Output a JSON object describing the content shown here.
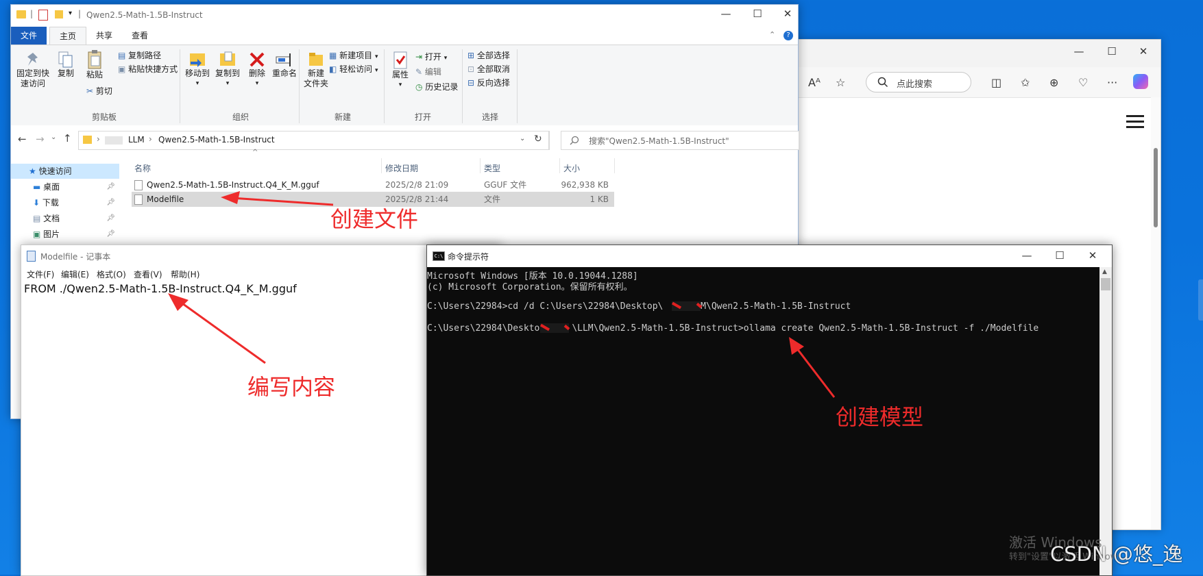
{
  "browser": {
    "search_placeholder": "点此搜索",
    "win_controls": [
      "—",
      "☐",
      "✕"
    ],
    "toolbar_icons": [
      "read-aloud-icon",
      "favorite-star-icon",
      "split-screen-icon",
      "favorites-icon",
      "collections-icon",
      "browser-essentials-icon",
      "more-icon",
      "copilot-icon"
    ]
  },
  "explorer": {
    "title": "Qwen2.5-Math-1.5B-Instruct",
    "tabs": [
      "文件",
      "主页",
      "共享",
      "查看"
    ],
    "ribbon": {
      "clipboard": {
        "pin_quick_access": "固定到快\n速访问",
        "copy": "复制",
        "paste": "粘贴",
        "copy_path": "复制路径",
        "paste_shortcut": "粘贴快捷方式",
        "cut": "剪切",
        "group_label": "剪贴板"
      },
      "organize": {
        "move_to": "移动到",
        "copy_to": "复制到",
        "delete": "删除",
        "rename": "重命名",
        "group_label": "组织"
      },
      "new": {
        "new_folder": "新建\n文件夹",
        "new_item": "新建项目",
        "easy_access": "轻松访问",
        "group_label": "新建"
      },
      "open": {
        "properties": "属性",
        "open": "打开",
        "edit": "编辑",
        "history": "历史记录",
        "group_label": "打开"
      },
      "select": {
        "select_all": "全部选择",
        "select_none": "全部取消",
        "invert": "反向选择",
        "group_label": "选择"
      }
    },
    "address": {
      "seg1": "LLM",
      "seg2": "Qwen2.5-Math-1.5B-Instruct",
      "search_placeholder": "搜索\"Qwen2.5-Math-1.5B-Instruct\""
    },
    "nav": {
      "quick_access": "快速访问",
      "items": [
        "桌面",
        "下载",
        "文档",
        "图片"
      ]
    },
    "columns": {
      "name": "名称",
      "modified": "修改日期",
      "type": "类型",
      "size": "大小"
    },
    "files": [
      {
        "name": "Qwen2.5-Math-1.5B-Instruct.Q4_K_M.gguf",
        "modified": "2025/2/8 21:09",
        "type": "GGUF 文件",
        "size": "962,938 KB"
      },
      {
        "name": "Modelfile",
        "modified": "2025/2/8 21:44",
        "type": "文件",
        "size": "1 KB"
      }
    ]
  },
  "notepad": {
    "title": "Modelfile - 记事本",
    "menu": [
      "文件(F)",
      "编辑(E)",
      "格式(O)",
      "查看(V)",
      "帮助(H)"
    ],
    "content": "FROM ./Qwen2.5-Math-1.5B-Instruct.Q4_K_M.gguf"
  },
  "cmd": {
    "title": "命令提示符",
    "lines": [
      "Microsoft Windows [版本 10.0.19044.1288]",
      "(c) Microsoft Corporation。保留所有权利。",
      "",
      "C:\\Users\\22984>cd /d C:\\Users\\22984\\Desktop\\    \\LLM\\Qwen2.5-Math-1.5B-Instruct",
      "",
      "C:\\Users\\22984\\Desktop\\    \\LLM\\Qwen2.5-Math-1.5B-Instruct>ollama create Qwen2.5-Math-1.5B-Instruct -f ./Modelfile"
    ]
  },
  "annotations": {
    "create_file": "创建文件",
    "write_content": "编写内容",
    "create_model": "创建模型",
    "color": "#ee2b2b"
  },
  "watermark": {
    "activate_line1": "激活 Windows",
    "activate_line2": "转到\"设置\"以激活 Windows。",
    "csdn": "CSDN @悠_逸"
  }
}
